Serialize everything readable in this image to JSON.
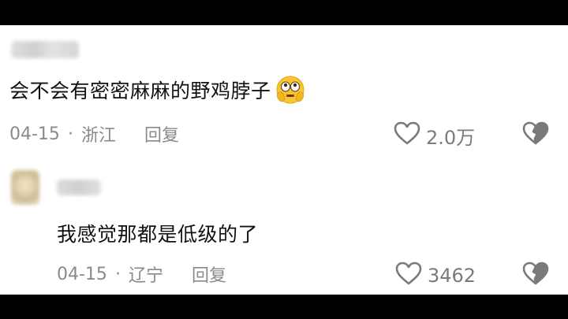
{
  "comment": {
    "text": "会不会有密密麻麻的野鸡脖子",
    "emoji": "face-with-peeking-eye-emoji",
    "date": "04-15",
    "separator": "·",
    "location": "浙江",
    "reply_label": "回复",
    "likes": "2.0万"
  },
  "reply": {
    "text": "我感觉那都是低级的了",
    "date": "04-15",
    "separator": "·",
    "location": "辽宁",
    "reply_label": "回复",
    "likes": "3462"
  },
  "icons": {
    "like": "heart-outline-icon",
    "dislike": "broken-heart-icon"
  },
  "colors": {
    "background": "#ffffff",
    "letterbox": "#000000",
    "text": "#111111",
    "meta": "#8a8a8a",
    "icon": "#7a7a7a"
  }
}
